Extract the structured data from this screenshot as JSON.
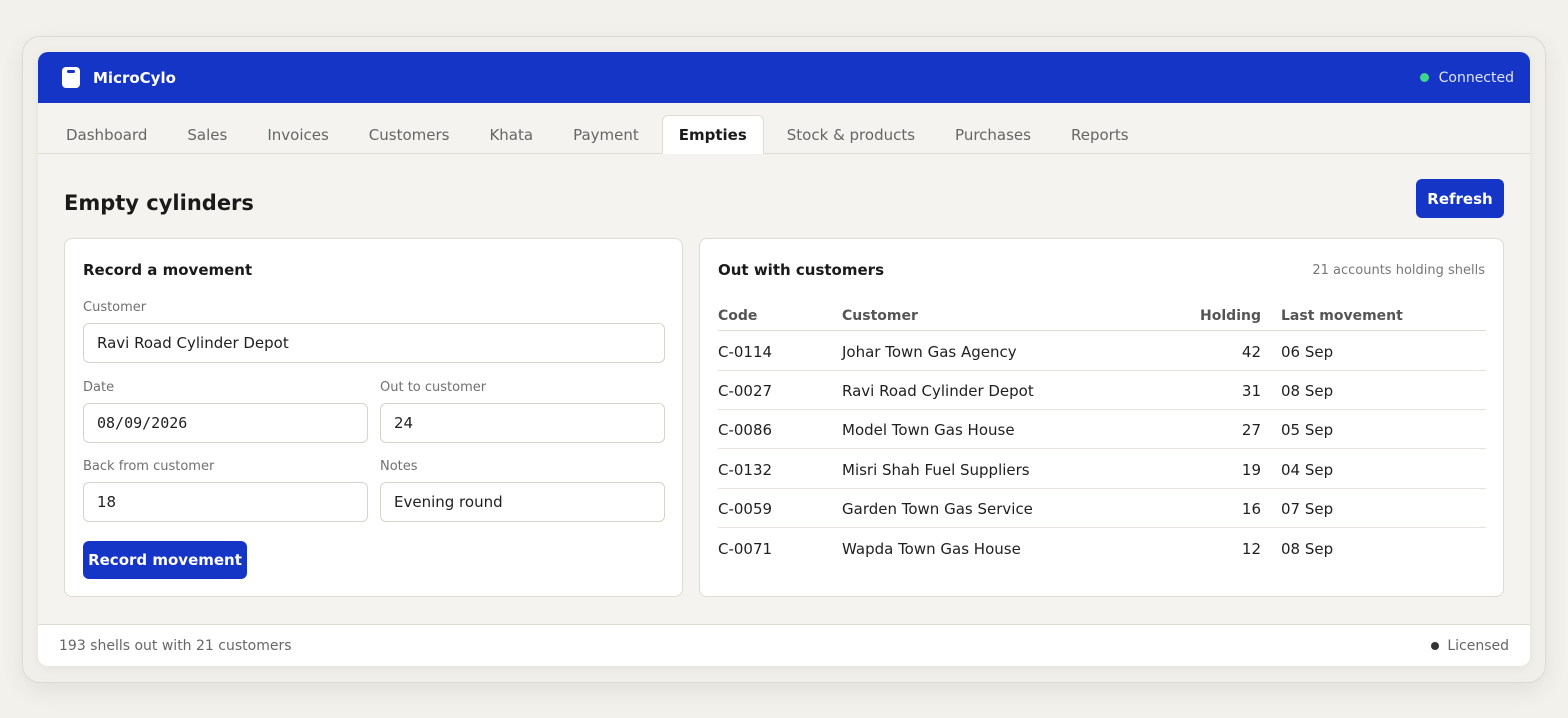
{
  "app": {
    "name": "MicroCylo",
    "connection_status": "Connected"
  },
  "tabs": [
    {
      "label": "Dashboard"
    },
    {
      "label": "Sales"
    },
    {
      "label": "Invoices"
    },
    {
      "label": "Customers"
    },
    {
      "label": "Khata"
    },
    {
      "label": "Payment"
    },
    {
      "label": "Empties",
      "active": true
    },
    {
      "label": "Stock & products"
    },
    {
      "label": "Purchases"
    },
    {
      "label": "Reports"
    }
  ],
  "page": {
    "title": "Empty cylinders",
    "refresh_label": "Refresh"
  },
  "form": {
    "title": "Record a movement",
    "customer_label": "Customer",
    "customer_value": "Ravi Road Cylinder Depot",
    "date_label": "Date",
    "date_value": "08/09/2026",
    "out_label": "Out to customer",
    "out_value": "24",
    "back_label": "Back from customer",
    "back_value": "18",
    "notes_label": "Notes",
    "notes_value": "Evening round",
    "submit_label": "Record movement"
  },
  "table": {
    "title": "Out with customers",
    "summary": "21 accounts holding shells",
    "headers": {
      "code": "Code",
      "customer": "Customer",
      "holding": "Holding",
      "last": "Last movement"
    },
    "rows": [
      {
        "code": "C-0114",
        "customer": "Johar Town Gas Agency",
        "holding": "42",
        "last": "06 Sep"
      },
      {
        "code": "C-0027",
        "customer": "Ravi Road Cylinder Depot",
        "holding": "31",
        "last": "08 Sep"
      },
      {
        "code": "C-0086",
        "customer": "Model Town Gas House",
        "holding": "27",
        "last": "05 Sep"
      },
      {
        "code": "C-0132",
        "customer": "Misri Shah Fuel Suppliers",
        "holding": "19",
        "last": "04 Sep"
      },
      {
        "code": "C-0059",
        "customer": "Garden Town Gas Service",
        "holding": "16",
        "last": "07 Sep"
      },
      {
        "code": "C-0071",
        "customer": "Wapda Town Gas House",
        "holding": "12",
        "last": "08 Sep"
      }
    ]
  },
  "statusbar": {
    "summary": "193 shells out with 21 customers",
    "license": "Licensed"
  },
  "colors": {
    "brand": "#1535c6",
    "connected": "#3dd68c"
  }
}
